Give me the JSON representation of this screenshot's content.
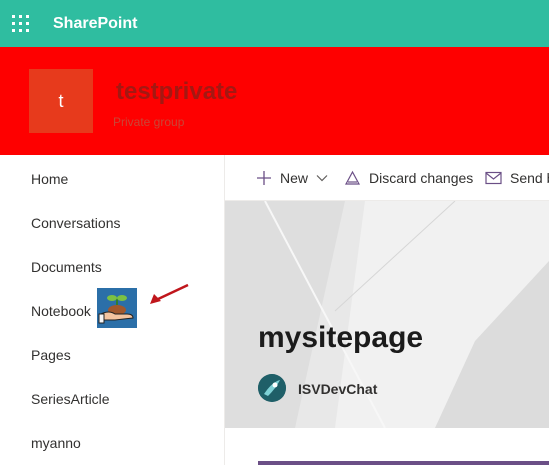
{
  "suite_bar": {
    "app_name": "SharePoint",
    "waffle_icon": "app-launcher-icon",
    "background_color": "#2fbda0"
  },
  "site_header": {
    "logo_letter": "t",
    "title": "testprivate",
    "subtitle": "Private group",
    "background_color": "#fe0000"
  },
  "left_nav": {
    "items": [
      {
        "label": "Home"
      },
      {
        "label": "Conversations"
      },
      {
        "label": "Documents"
      },
      {
        "label": "Notebook"
      },
      {
        "label": "Pages"
      },
      {
        "label": "SeriesArticle"
      },
      {
        "label": "myanno"
      }
    ],
    "notebook_icon": "plant-in-hand-icon",
    "annotation_icon": "red-arrow-icon"
  },
  "command_bar": {
    "new_label": "New",
    "discard_label": "Discard changes",
    "send_label": "Send b"
  },
  "page": {
    "title": "mysitepage",
    "author": "ISVDevChat"
  }
}
